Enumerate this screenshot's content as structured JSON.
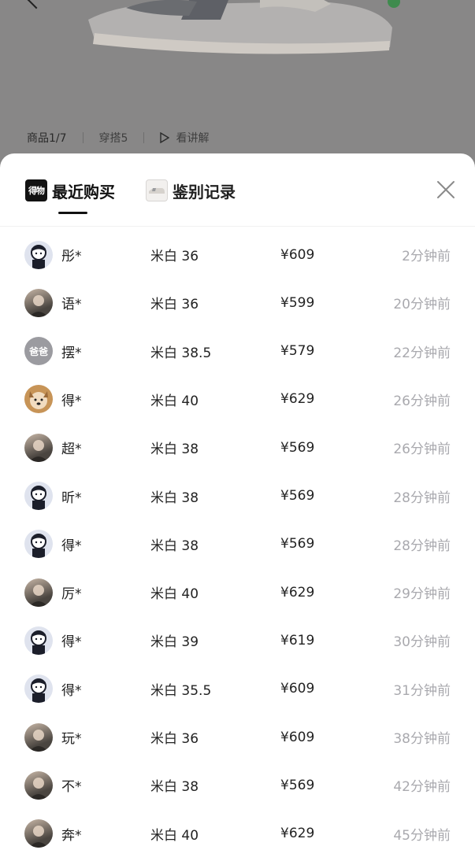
{
  "product": {
    "tabs": [
      {
        "label": "商品1/7"
      },
      {
        "label": "穿搭5"
      },
      {
        "label": "看讲解"
      }
    ]
  },
  "sheet": {
    "tab_recent": {
      "badge": "得物",
      "label": "最近购买"
    },
    "tab_auth": {
      "label": "鉴别记录"
    },
    "rows": [
      {
        "avatar_icon": "cartoon-avatar",
        "user": "彤*",
        "spec": "米白 36",
        "price": "¥609",
        "time": "2分钟前"
      },
      {
        "avatar_icon": "photo-avatar",
        "user": "语*",
        "spec": "米白 36",
        "price": "¥599",
        "time": "20分钟前"
      },
      {
        "avatar_icon": "text-avatar",
        "avatar_text": "爸爸",
        "user": "摆*",
        "spec": "米白 38.5",
        "price": "¥579",
        "time": "22分钟前"
      },
      {
        "avatar_icon": "dog-avatar",
        "user": "得*",
        "spec": "米白 40",
        "price": "¥629",
        "time": "26分钟前"
      },
      {
        "avatar_icon": "photo-avatar",
        "user": "超*",
        "spec": "米白 38",
        "price": "¥569",
        "time": "26分钟前"
      },
      {
        "avatar_icon": "cartoon-avatar",
        "user": "昕*",
        "spec": "米白 38",
        "price": "¥569",
        "time": "28分钟前"
      },
      {
        "avatar_icon": "cartoon-avatar",
        "user": "得*",
        "spec": "米白 38",
        "price": "¥569",
        "time": "28分钟前"
      },
      {
        "avatar_icon": "photo-avatar",
        "user": "厉*",
        "spec": "米白 40",
        "price": "¥629",
        "time": "29分钟前"
      },
      {
        "avatar_icon": "cartoon-avatar",
        "user": "得*",
        "spec": "米白 39",
        "price": "¥619",
        "time": "30分钟前"
      },
      {
        "avatar_icon": "cartoon-avatar",
        "user": "得*",
        "spec": "米白 35.5",
        "price": "¥609",
        "time": "31分钟前"
      },
      {
        "avatar_icon": "photo-avatar",
        "user": "玩*",
        "spec": "米白 36",
        "price": "¥609",
        "time": "38分钟前"
      },
      {
        "avatar_icon": "photo-avatar",
        "user": "不*",
        "spec": "米白 38",
        "price": "¥569",
        "time": "42分钟前"
      },
      {
        "avatar_icon": "photo-avatar",
        "user": "奔*",
        "spec": "米白 40",
        "price": "¥629",
        "time": "45分钟前"
      }
    ]
  },
  "colors": {
    "overlay": "#888787",
    "sheet_bg": "#ffffff",
    "text_primary": "#222222",
    "text_secondary": "#a9a9ae"
  }
}
